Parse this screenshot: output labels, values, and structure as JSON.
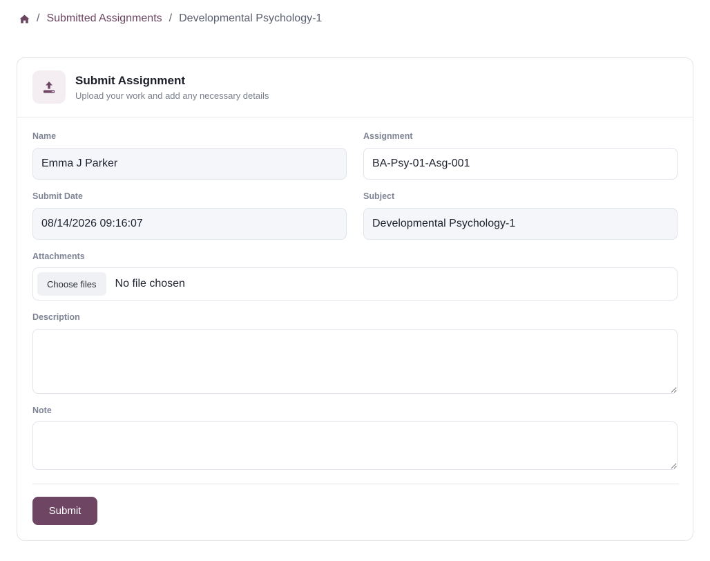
{
  "breadcrumb": {
    "home_icon": "home-icon",
    "separator": "/",
    "items": [
      {
        "label": "Submitted Assignments"
      },
      {
        "label": "Developmental Psychology-1"
      }
    ]
  },
  "card": {
    "icon": "upload-icon",
    "title": "Submit Assignment",
    "subtitle": "Upload your work and add any necessary details"
  },
  "form": {
    "name": {
      "label": "Name",
      "value": "Emma J Parker"
    },
    "assignment": {
      "label": "Assignment",
      "value": "BA-Psy-01-Asg-001"
    },
    "submit_date": {
      "label": "Submit Date",
      "value": "08/14/2026 09:16:07"
    },
    "subject": {
      "label": "Subject",
      "value": "Developmental Psychology-1"
    },
    "attachments": {
      "label": "Attachments",
      "button_label": "Choose files",
      "status": "No file chosen"
    },
    "description": {
      "label": "Description",
      "value": ""
    },
    "note": {
      "label": "Note",
      "value": ""
    },
    "submit_label": "Submit"
  },
  "colors": {
    "accent": "#6e4563",
    "link": "#6b4560",
    "readonly_bg": "#f5f6fa"
  }
}
